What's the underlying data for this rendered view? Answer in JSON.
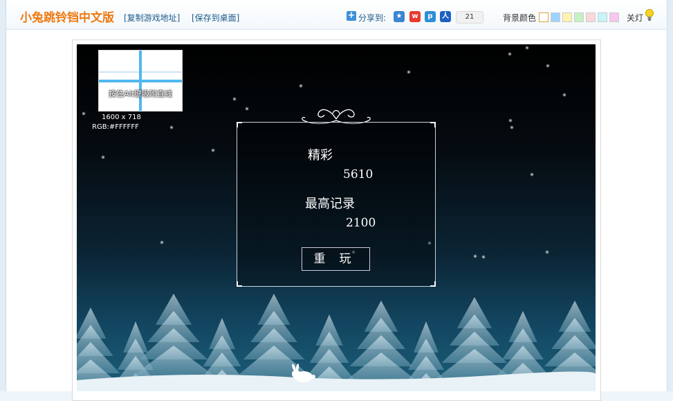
{
  "header": {
    "site_title": "小兔跳铃铛中文版",
    "copy_link": "[复制游戏地址]",
    "save_desktop": "[保存到桌面]",
    "share_label": "分享到:",
    "share_count": "21",
    "bg_color_label": "背景颜色",
    "bg_colors": [
      "#ffffff",
      "#9fd3ff",
      "#fff3b0",
      "#c5f2c0",
      "#f8d8d8",
      "#c6f4f7",
      "#f8c6ee"
    ],
    "light_label": "关灯"
  },
  "ruler": {
    "hint": "按住Alt键吸附直线",
    "size": "1600 x 718",
    "rgb": "RGB:#FFFFFF"
  },
  "score_panel": {
    "score_title": "精彩",
    "score_value": "5610",
    "best_title": "最高记录",
    "best_value": "2100",
    "replay_label": "重玩"
  },
  "colors": {
    "title_orange": "#ef7a12",
    "link_blue": "#1c5a8a",
    "guide_blue": "#4fb8ef"
  }
}
